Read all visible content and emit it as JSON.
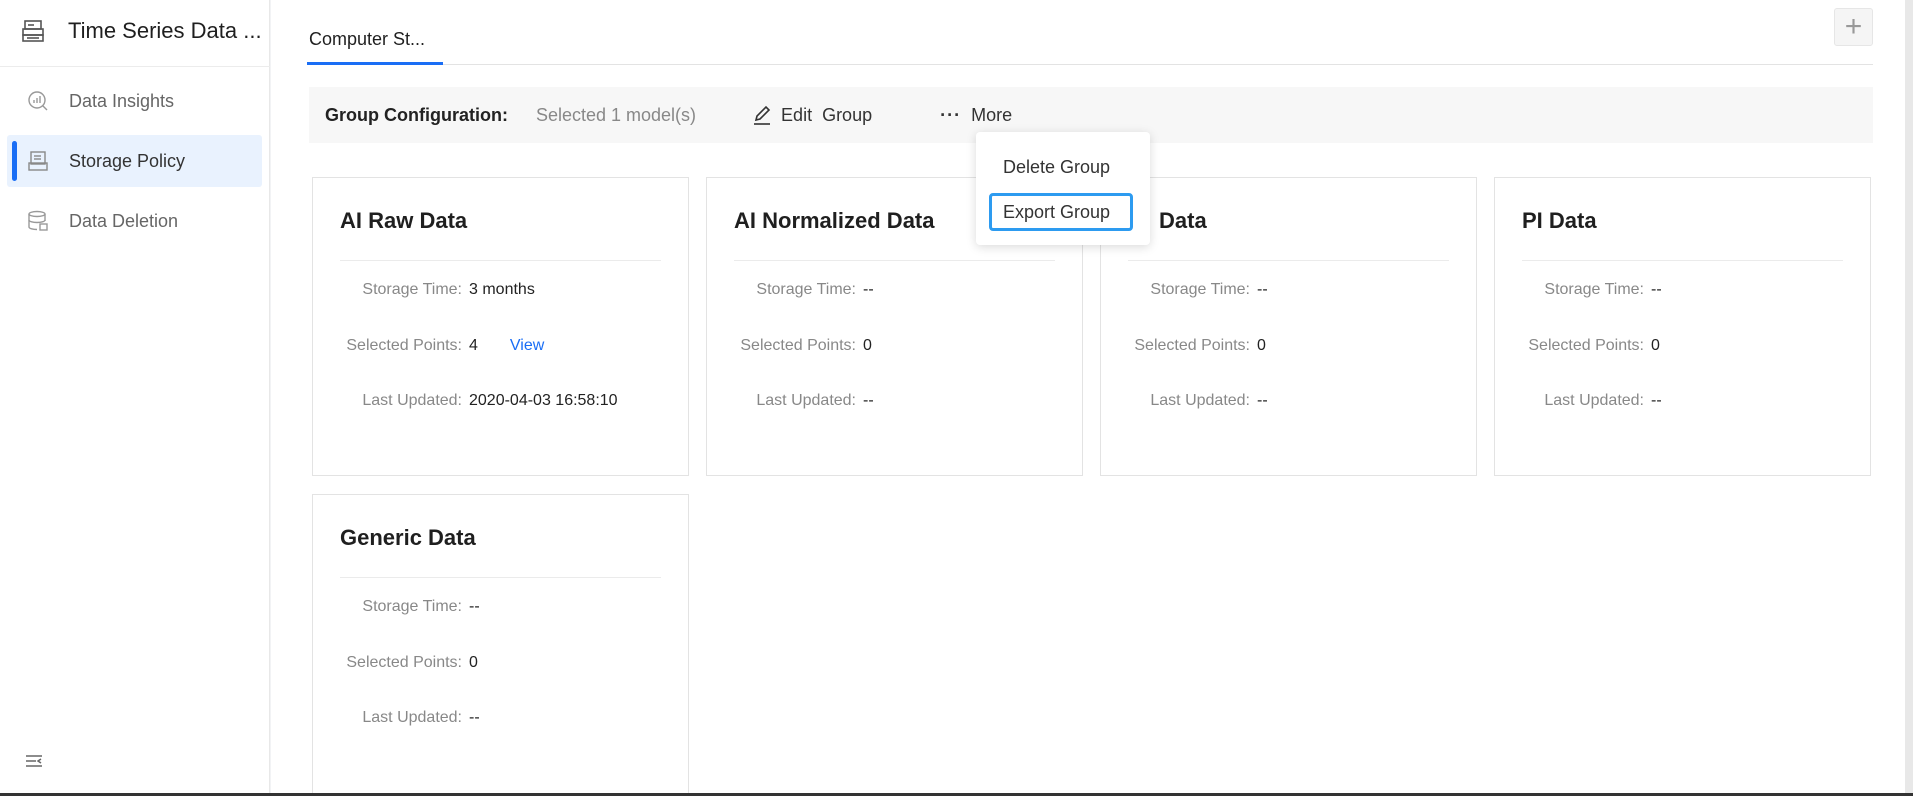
{
  "sidebar": {
    "app_title": "Time Series Data ...",
    "items": [
      {
        "label": "Data Insights",
        "icon": "chart-search-icon"
      },
      {
        "label": "Storage Policy",
        "icon": "storage-icon",
        "active": true
      },
      {
        "label": "Data Deletion",
        "icon": "database-delete-icon"
      }
    ]
  },
  "tabs": [
    {
      "label": "Computer St...",
      "active": true
    }
  ],
  "toolbar": {
    "label": "Group Configuration:",
    "selected": "Selected 1 model(s)",
    "edit": "Edit  Group",
    "more": "More"
  },
  "dropdown": {
    "items": [
      "Delete Group",
      "Export Group"
    ],
    "focused": "Export Group"
  },
  "cards": [
    {
      "title": "AI Raw Data",
      "storage_label": "Storage Time:",
      "storage": "3 months",
      "points_label": "Selected Points:",
      "points": "4",
      "view": "View",
      "updated_label": "Last Updated:",
      "updated": "2020-04-03 16:58:10"
    },
    {
      "title": "AI Normalized Data",
      "storage_label": "Storage Time:",
      "storage": "--",
      "points_label": "Selected Points:",
      "points": "0",
      "updated_label": "Last Updated:",
      "updated": "--"
    },
    {
      "title": "Data",
      "storage_label": "Storage Time:",
      "storage": "--",
      "points_label": "Selected Points:",
      "points": "0",
      "updated_label": "Last Updated:",
      "updated": "--"
    },
    {
      "title": "PI Data",
      "storage_label": "Storage Time:",
      "storage": "--",
      "points_label": "Selected Points:",
      "points": "0",
      "updated_label": "Last Updated:",
      "updated": "--"
    },
    {
      "title": "Generic Data",
      "storage_label": "Storage Time:",
      "storage": "--",
      "points_label": "Selected Points:",
      "points": "0",
      "updated_label": "Last Updated:",
      "updated": "--"
    }
  ],
  "colors": {
    "accent": "#1a6ef5",
    "focus": "#2d9bf0",
    "active_bg": "#e9f2fe"
  }
}
